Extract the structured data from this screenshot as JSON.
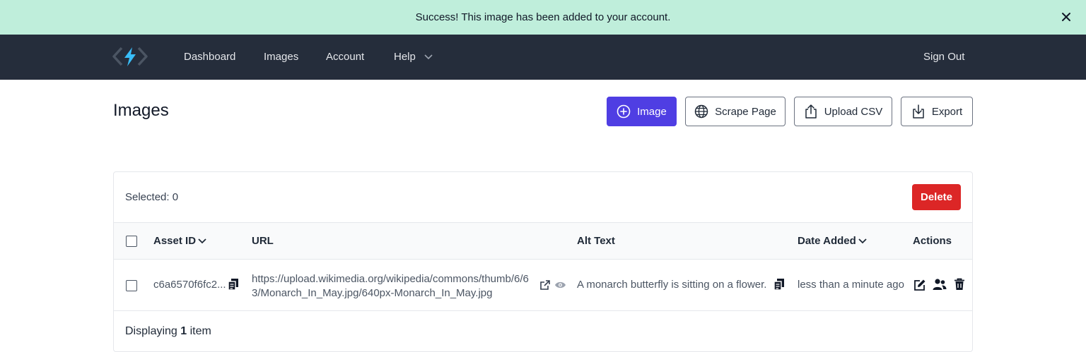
{
  "banner": {
    "message": "Success! This image has been added to your account."
  },
  "nav": {
    "items": [
      "Dashboard",
      "Images",
      "Account",
      "Help"
    ],
    "sign_out": "Sign Out"
  },
  "page": {
    "title": "Images"
  },
  "toolbar": {
    "image_label": "Image",
    "scrape_label": "Scrape Page",
    "upload_label": "Upload CSV",
    "export_label": "Export"
  },
  "table": {
    "selected_text": "Selected: 0",
    "delete_label": "Delete",
    "columns": [
      "Asset ID",
      "URL",
      "Alt Text",
      "Date Added",
      "Actions"
    ],
    "rows": [
      {
        "asset_id": "c6a6570f6fc2...",
        "url": "https://upload.wikimedia.org/wikipedia/commons/thumb/6/63/Monarch_In_May.jpg/640px-Monarch_In_May.jpg",
        "alt_text": "A monarch butterfly is sitting on a flower.",
        "date_added": "less than a minute ago"
      }
    ],
    "footer_prefix": "Displaying",
    "footer_count": "1",
    "footer_suffix": "item"
  },
  "colors": {
    "banner_bg": "#bfeedb",
    "nav_bg": "#252d3b",
    "primary": "#4f3ee3",
    "danger": "#dc2626"
  }
}
